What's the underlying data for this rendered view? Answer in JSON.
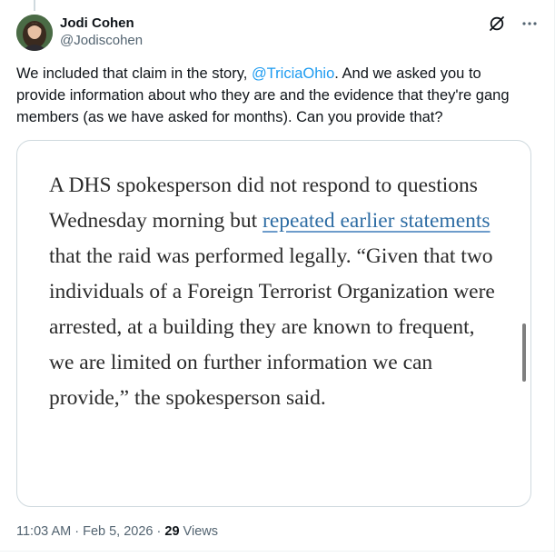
{
  "author": {
    "display_name": "Jodi Cohen",
    "handle": "@Jodiscohen"
  },
  "header_icons": [
    "grok-icon",
    "more-icon"
  ],
  "tweet": {
    "text_before": "We included that claim in the story, ",
    "mention": "@TriciaOhio",
    "text_after": ". And we asked you to provide information about who they are and the evidence that they're gang members (as we have asked for months). Can you provide that?"
  },
  "quote_card": {
    "text_before_link": "A DHS spokesperson did not respond to questions Wednesday morning but ",
    "link_text": "repeated earlier statements",
    "text_after_link": " that the raid was performed legally. “Given that two individuals of a Foreign Terrorist Organization were arrested, at a building they are known to frequent, we are limited on further information we can provide,” the spokesperson said."
  },
  "meta": {
    "time": "11:03 AM",
    "separator": " · ",
    "date": "Feb 5, 2026",
    "views_count": "29",
    "views_label": " Views"
  },
  "colors": {
    "link_blue": "#1d9bf0",
    "secondary_text": "#536471",
    "quote_link": "#2e6da4"
  }
}
